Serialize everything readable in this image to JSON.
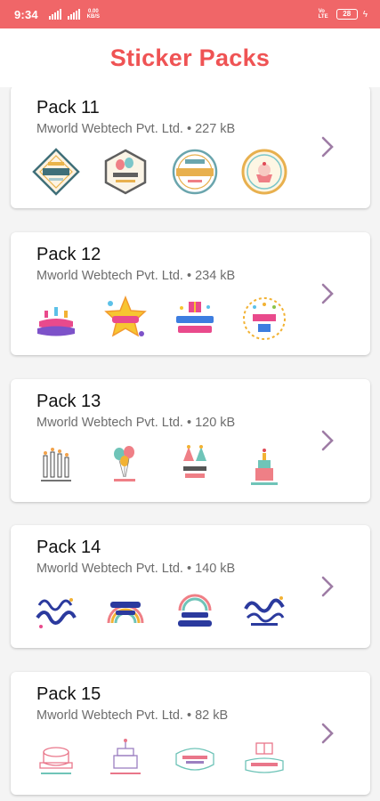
{
  "status_bar": {
    "time": "9:34",
    "speed": "0.00 KB/S",
    "volte": "Vo LTE",
    "battery": "28"
  },
  "header": {
    "title": "Sticker Packs"
  },
  "accent_color": "#f06668",
  "title_color": "#ef5354",
  "packs": [
    {
      "name": "Pack 11",
      "meta": "Mworld Webtech Pvt. Ltd. • 227 kB",
      "stickers": [
        "happy-birthday-diamond-badge",
        "birthday-balloons-hexagon-badge",
        "birthday-party-circle-badge",
        "birthday-cupcake-round-badge"
      ]
    },
    {
      "name": "Pack 12",
      "meta": "Mworld Webtech Pvt. Ltd. • 234 kB",
      "stickers": [
        "happy-birthday-cake-sticker",
        "birthday-star-sticker",
        "happy-birthday-gift-sticker",
        "birthday-confetti-circle-sticker"
      ]
    },
    {
      "name": "Pack 13",
      "meta": "Mworld Webtech Pvt. Ltd. • 120 kB",
      "stickers": [
        "make-a-wish-candles-sticker",
        "balloons-birthday-sticker",
        "lets-party-hats-sticker",
        "happy-birthday-cake-tower-sticker"
      ]
    },
    {
      "name": "Pack 14",
      "meta": "Mworld Webtech Pvt. Ltd. • 140 kB",
      "stickers": [
        "be-happy-lettering-sticker",
        "magical-day-rainbow-sticker",
        "best-wishes-rainbow-sticker",
        "enjoy-your-day-lettering-sticker"
      ]
    },
    {
      "name": "Pack 15",
      "meta": "Mworld Webtech Pvt. Ltd. • 82 kB",
      "stickers": [
        "happy-birthday-cake-line-sticker",
        "birthday-castle-cake-sticker",
        "happy-birthday-ribbon-sticker",
        "happy-birthday-gift-line-sticker"
      ]
    }
  ]
}
